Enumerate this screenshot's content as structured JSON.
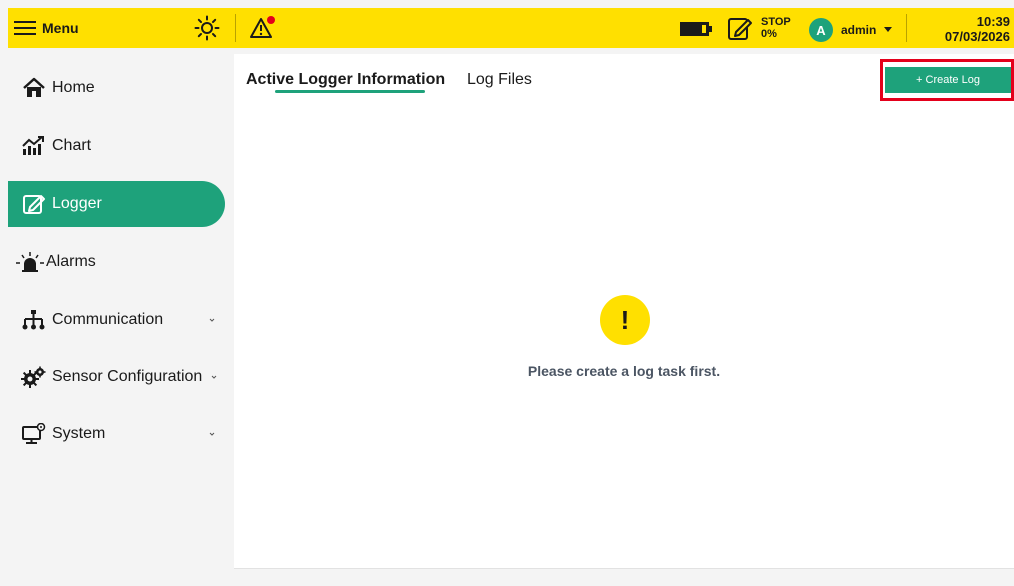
{
  "topbar": {
    "menu_label": "Menu",
    "log_status_state": "STOP",
    "log_status_percent": "0%",
    "user_initial": "A",
    "user_name": "admin",
    "time": "10:39",
    "date": "07/03/2026",
    "brand_color": "#ffe000",
    "alarm_dot_color": "#e4001b",
    "icons": [
      "menu-icon",
      "brightness-icon",
      "alarm-warning-icon",
      "battery-icon",
      "logger-status-icon",
      "chevron-down-icon"
    ]
  },
  "sidebar": {
    "active_color": "#1ea27b",
    "items": [
      {
        "label": "Home",
        "icon": "home-icon"
      },
      {
        "label": "Chart",
        "icon": "chart-icon"
      },
      {
        "label": "Logger",
        "icon": "logger-icon",
        "active": true
      },
      {
        "label": "Alarms",
        "icon": "alarm-light-icon"
      },
      {
        "label": "Communication",
        "icon": "network-icon",
        "expandable": true
      },
      {
        "label": "Sensor Configuration",
        "icon": "gear-icon",
        "expandable": true
      },
      {
        "label": "System",
        "icon": "monitor-icon",
        "expandable": true
      }
    ]
  },
  "main": {
    "tabs": [
      {
        "label": "Active Logger Information",
        "active": true
      },
      {
        "label": "Log Files"
      }
    ],
    "create_button_label": "+ Create Log",
    "empty_icon": "exclamation-icon",
    "empty_message": "Please create a log task first."
  }
}
